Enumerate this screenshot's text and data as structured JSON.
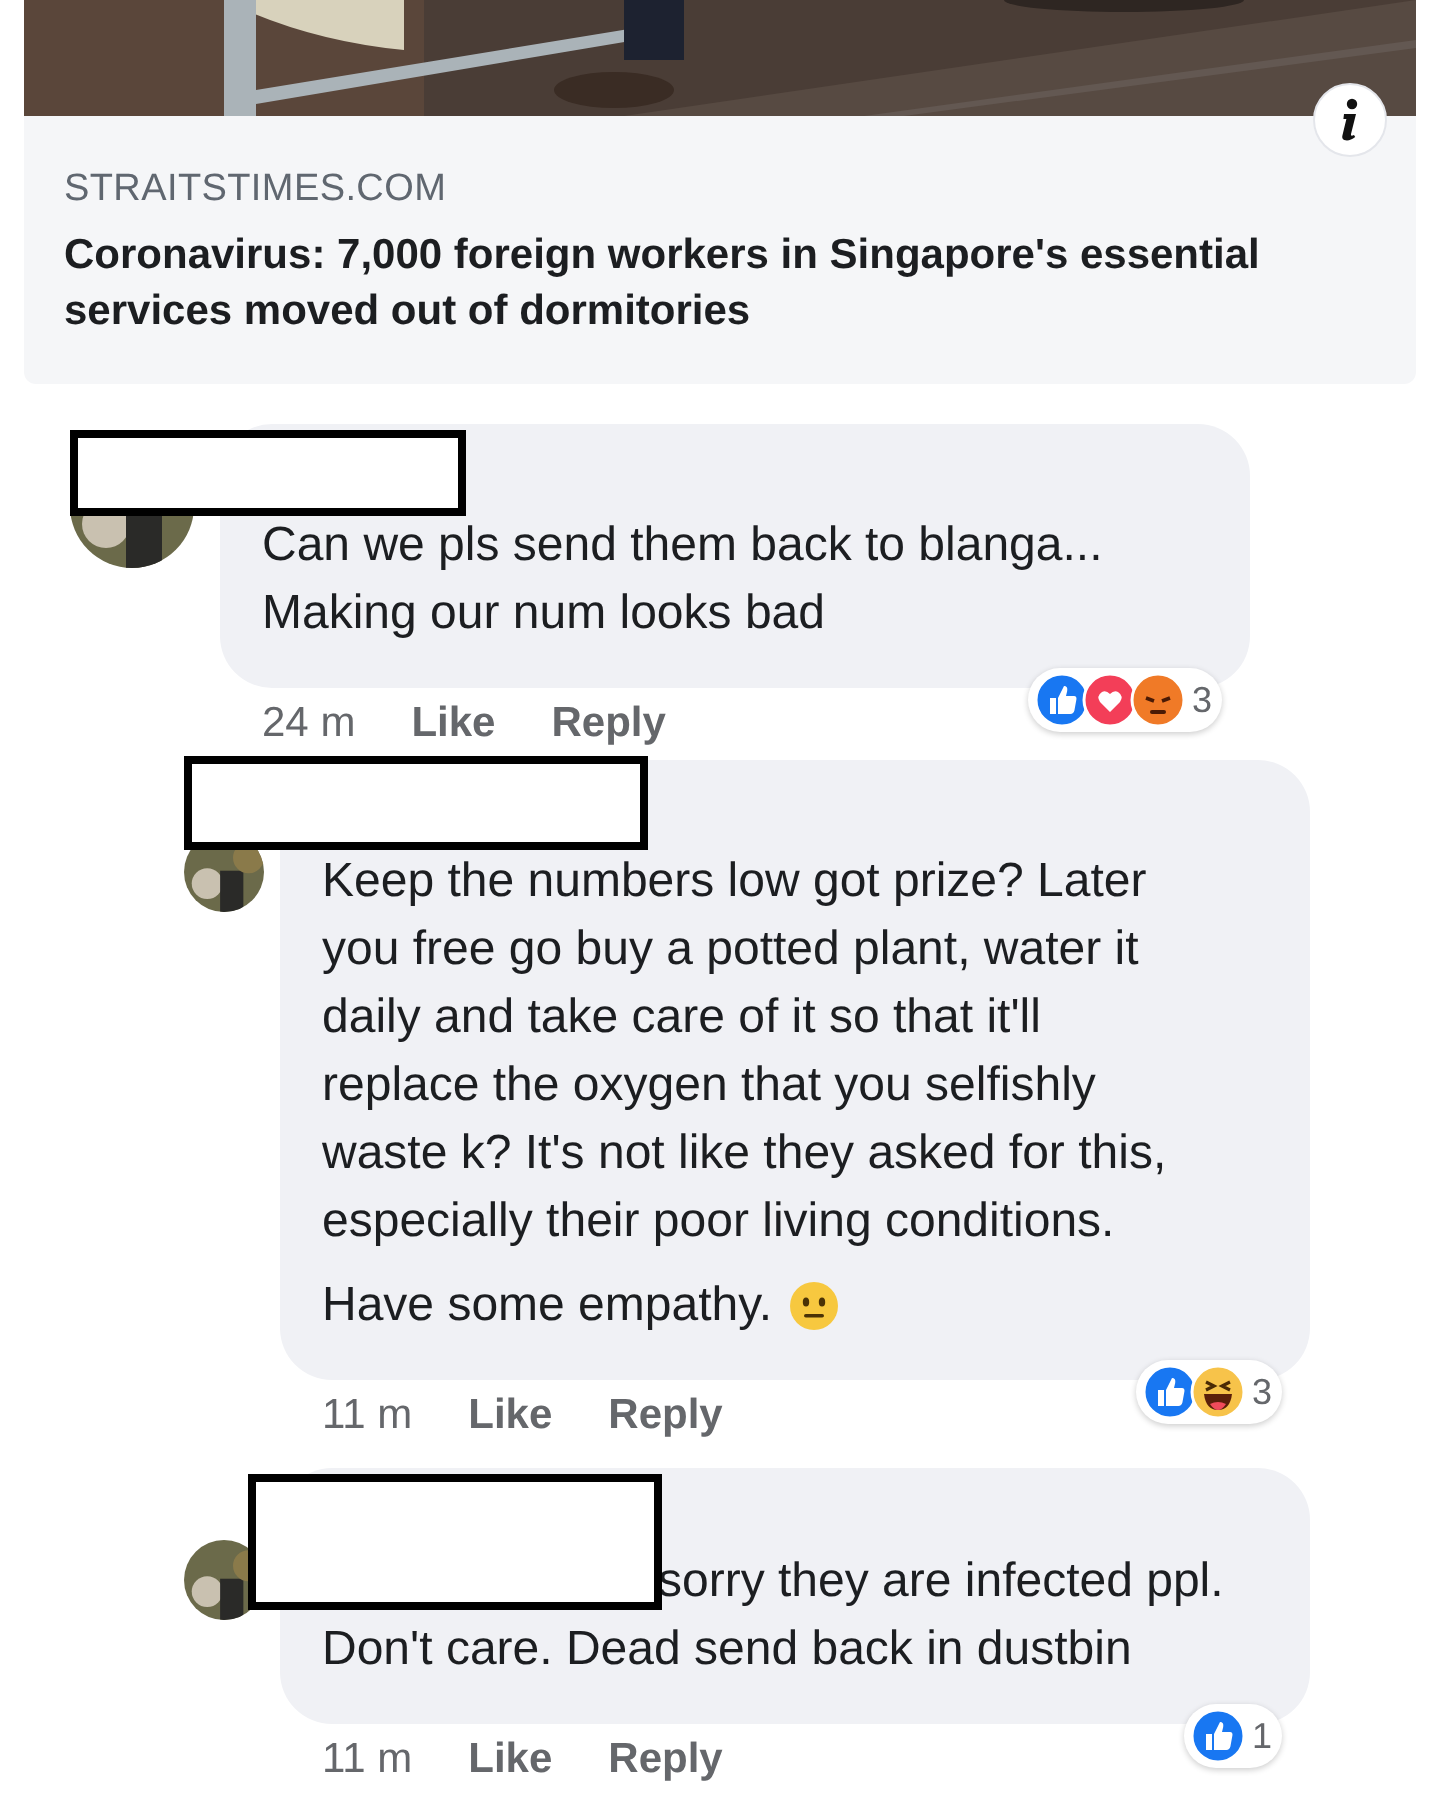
{
  "link_preview": {
    "source": "STRAITSTIMES.COM",
    "headline": "Coronavirus: 7,000 foreign workers in Singapore's essential services moved out of dormitories"
  },
  "comments": [
    {
      "text": "Can we pls send them back to blanga...\nMaking our num looks bad",
      "time": "24 m",
      "actions": [
        "Like",
        "Reply"
      ],
      "reactions": [
        {
          "kind": "like"
        },
        {
          "kind": "love"
        },
        {
          "kind": "angry"
        }
      ],
      "reaction_count": "3",
      "children": [
        {
          "paragraphs": [
            {
              "kind": "plain",
              "text": "Keep the numbers low got prize? Later\nyou free go buy a potted plant, water it\ndaily and take care of it so that it'll\nreplace the oxygen that you selfishly\nwaste k? It's not like they asked for this,\nespecially their poor living conditions."
            },
            {
              "kind": "neutral_emoji",
              "text": "Have some empathy."
            }
          ],
          "time": "11 m",
          "actions": [
            "Like",
            "Reply"
          ],
          "reactions": [
            {
              "kind": "like"
            },
            {
              "kind": "haha"
            }
          ],
          "reaction_count": "3"
        },
        {
          "text": "sorry they are infected ppl.\nDon't care. Dead send back in dustbin",
          "name_inline": true,
          "time": "11 m",
          "actions": [
            "Like",
            "Reply"
          ],
          "reactions": [
            {
              "kind": "like"
            }
          ],
          "reaction_count": "1"
        }
      ]
    }
  ]
}
